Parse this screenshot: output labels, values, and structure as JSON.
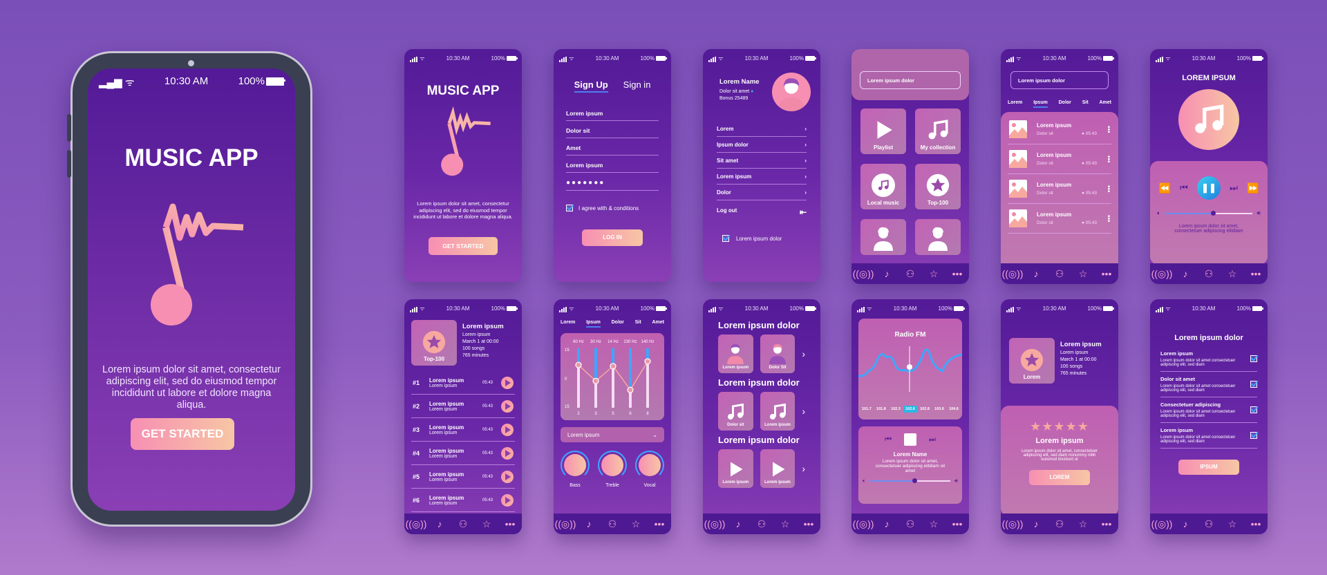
{
  "status": {
    "time": "10:30 AM",
    "battery": "100%"
  },
  "nav_icons": [
    "radio-icon",
    "music-note-icon",
    "user-icon",
    "star-icon",
    "more-icon"
  ],
  "colors": {
    "accent_pink": "#f78fb3",
    "accent_peach": "#f7c6a4",
    "bg_purple": "#531a97",
    "blue": "#3fa6ff"
  },
  "welcome": {
    "title": "MUSIC APP",
    "text": "Lorem ipsum dolor sit amet, consectetur adipiscing elit, sed do eiusmod tempor incididunt ut labore et dolore magna aliqua.",
    "button": "GET STARTED"
  },
  "signup": {
    "tab_active": "Sign Up",
    "tab_other": "Sign in",
    "fields": [
      "Lorem ipsum",
      "Dolor sit",
      "Amet",
      "Lorem ipsum"
    ],
    "password": "●●●●●●●",
    "agree": "I agree with & conditions",
    "button": "LOG IN"
  },
  "profile": {
    "name": "Lorem Name",
    "location": "Dolor sit amet",
    "bonus": "Bonus 25489",
    "items": [
      "Lorem",
      "Ipsum dolor",
      "Sit amet",
      "Lorem ipsum",
      "Dolor"
    ],
    "logout": "Log out",
    "checkbox": "Lorem ipsum dolor"
  },
  "library": {
    "search": "Lorem ipsum dolor",
    "tiles": [
      "Playlist",
      "My collection",
      "Local music",
      "Top-100"
    ]
  },
  "tracks": {
    "search": "Lorem ipsum dolor",
    "tabs": [
      "Lorem",
      "Ipsum",
      "Dolor",
      "Sit",
      "Amet"
    ],
    "items": [
      {
        "title": "Lorem ipsum",
        "sub": "Dolor sit",
        "time": "05:43"
      },
      {
        "title": "Lorem ipsum",
        "sub": "Dolor sit",
        "time": "05:43"
      },
      {
        "title": "Lorem ipsum",
        "sub": "Dolor sit",
        "time": "05:43"
      },
      {
        "title": "Lorem ipsum",
        "sub": "Dolor sit",
        "time": "05:43"
      }
    ]
  },
  "player": {
    "title": "LOREM IPSUM",
    "volume": 0.55,
    "text": "Lorem ipsum dolor sit amet, consectetuer adipiscing elitdiam"
  },
  "top100": {
    "tile": "Top-100",
    "title": "Lorem ipsum",
    "lines": [
      "Lorem ipsum",
      "March 1 at 00:00",
      "100 songs",
      "765 minutes"
    ],
    "items": [
      {
        "rank": "#1",
        "title": "Lorem ipsum",
        "sub": "Lorem ipsum",
        "time": "05:43"
      },
      {
        "rank": "#2",
        "title": "Lorem ipsum",
        "sub": "Lorem ipsum",
        "time": "05:43"
      },
      {
        "rank": "#3",
        "title": "Lorem ipsum",
        "sub": "Lorem ipsum",
        "time": "05:43"
      },
      {
        "rank": "#4",
        "title": "Lorem ipsum",
        "sub": "Lorem ipsum",
        "time": "05:43"
      },
      {
        "rank": "#5",
        "title": "Lorem ipsum",
        "sub": "Lorem ipsum",
        "time": "05:43"
      },
      {
        "rank": "#6",
        "title": "Lorem ipsum",
        "sub": "Lorem ipsum",
        "time": "05:43"
      }
    ]
  },
  "equalizer": {
    "tabs": [
      "Lorem",
      "Ipsum",
      "Dolor",
      "Sit",
      "Amet"
    ],
    "bands": [
      "60 Hz",
      "30 Hz",
      "14 Hz",
      "230 Hz",
      "140 Hz"
    ],
    "band_numbers": [
      "2",
      "3",
      "5",
      "6",
      "8"
    ],
    "levels": [
      0.72,
      0.45,
      0.7,
      0.3,
      0.78
    ],
    "scale": [
      "15",
      "0",
      "15"
    ],
    "preset": "Lorem ipsum",
    "knobs": [
      "Bass",
      "Treble",
      "Vocal"
    ]
  },
  "browse": {
    "sections": [
      {
        "title": "Lorem ipsum dolor",
        "tiles": [
          "Lorem ipsum",
          "Dolor Sit"
        ]
      },
      {
        "title": "Lorem ipsum dolor",
        "tiles": [
          "Dolor sit",
          "Lorem ipsum"
        ]
      },
      {
        "title": "Lorem ipsum dolor",
        "tiles": [
          "Lorem ipsum",
          "Lorem ipsum"
        ]
      }
    ]
  },
  "radio": {
    "title": "Radio FM",
    "freqs": [
      "101.7",
      "101.8",
      "102.3",
      "102.6",
      "102.8",
      "103.6",
      "104.6"
    ],
    "selected": "102.6",
    "name": "Lorem Name",
    "text": "Lorem ipsum dolor sit amet, consectetuer adipiscing elitdiam sit amet",
    "volume": 0.55
  },
  "rating": {
    "tile": "Lorem",
    "title": "Lorem ipsum",
    "lines": [
      "Lorem ipsum",
      "March 1 at 00:00",
      "100 songs",
      "765 minutes"
    ],
    "stars": 5,
    "card_title": "Lorem ipsum",
    "card_text": "Lorem ipsum dolor sit amet, consectetuer adipiscing elit, sed diam nonummy nibh euismod tincidunt ut",
    "button": "LOREM"
  },
  "settings": {
    "title": "Lorem ipsum dolor",
    "items": [
      {
        "title": "Lorem ipsum",
        "text": "Lorem ipsum dolor sit amet consectetuer adipiscing elit, sed diam"
      },
      {
        "title": "Dolor sit amet",
        "text": "Lorem ipsum dolor sit amet consectetuer adipiscing elit, sed diam"
      },
      {
        "title": "Consectetuer adipiscing",
        "text": "Lorem ipsum dolor sit amet consectetuer adipiscing elit, sed diam"
      },
      {
        "title": "Lorem ipsum",
        "text": "Lorem ipsum dolor sit amet consectetuer adipiscing elit, sed diam"
      }
    ],
    "button": "IPSUM"
  }
}
